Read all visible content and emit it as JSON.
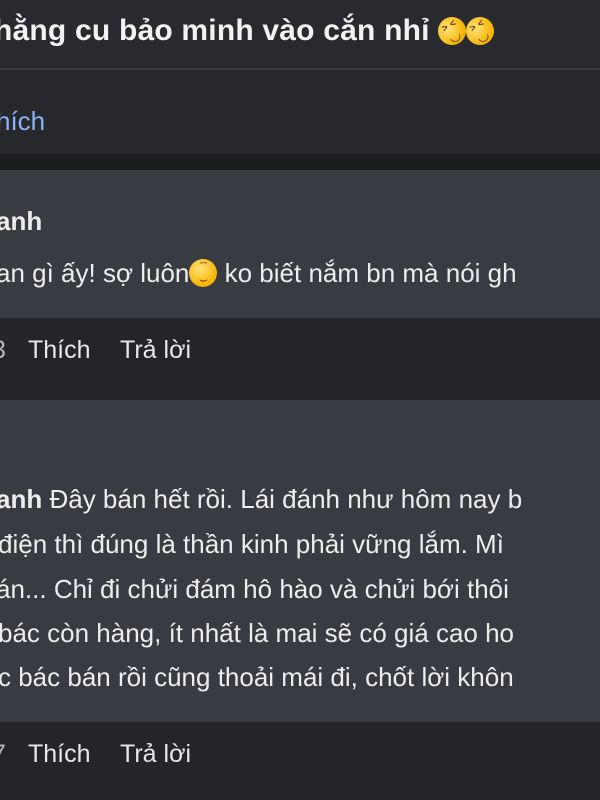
{
  "post": {
    "title": "hằng cu bảo minh vào cắn nhỉ",
    "title_emoji": "rolling-on-floor-laughing-icon",
    "like_label": "hích"
  },
  "comments": [
    {
      "author": "anh",
      "lines": [
        "an gì ấy! sợ luôn",
        " ko biết nắm bn mà nói gh"
      ],
      "emoji": "grinning-face-icon",
      "count": "3",
      "like_label": "Thích",
      "reply_label": "Trả lời"
    },
    {
      "author": "anh",
      "lines": [
        " Đây bán hết rồi. Lái đánh như hôm nay b",
        "điện thì đúng là thần kinh phải vững lắm. Mì",
        "án... Chỉ đi chửi đám hô hào và chửi bới thôi",
        "bác còn hàng, ít nhất là mai sẽ có giá cao ho",
        "c bác bán rồi cũng thoải mái đi, chốt lời khôn"
      ],
      "count": "7",
      "like_label": "Thích",
      "reply_label": "Trả lời"
    }
  ]
}
